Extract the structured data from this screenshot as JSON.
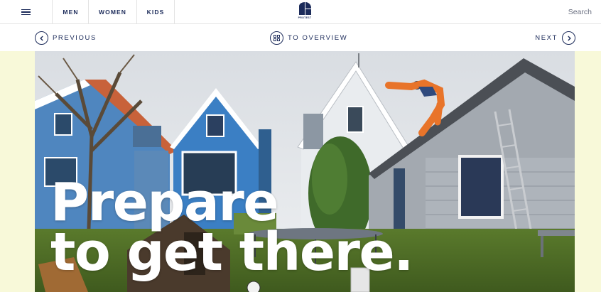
{
  "nav": {
    "items": [
      {
        "label": "MEN"
      },
      {
        "label": "WOMEN"
      },
      {
        "label": "KIDS"
      }
    ],
    "search_label": "Search",
    "logo_text": "PROTEST"
  },
  "subnav": {
    "previous_label": "PREVIOUS",
    "overview_label": "TO OVERVIEW",
    "next_label": "NEXT"
  },
  "hero": {
    "headline_line1": "Prepare",
    "headline_line2": "to get there."
  },
  "colors": {
    "brand_navy": "#1c2b5a",
    "side_background": "#f8f9d9",
    "hero_text": "#ffffff"
  },
  "icons": [
    "hamburger-icon",
    "protest-logo",
    "chevron-left-icon",
    "grid-icon",
    "chevron-right-icon"
  ]
}
